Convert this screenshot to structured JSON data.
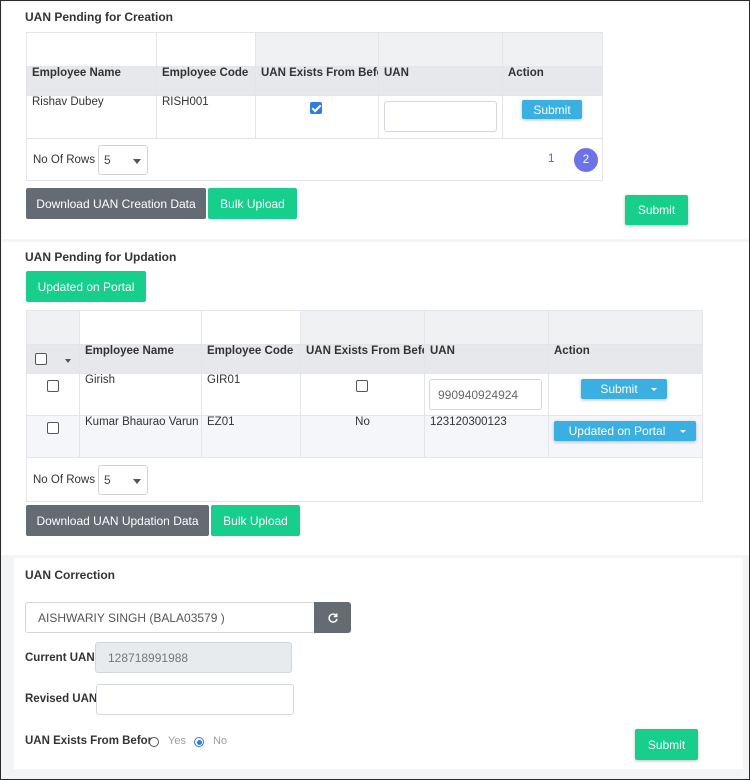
{
  "creation": {
    "title": "UAN Pending for Creation",
    "columns": [
      "Employee Name",
      "Employee Code",
      "UAN Exists From Before",
      "UAN",
      "Action"
    ],
    "rows": [
      {
        "name": "Rishav Dubey",
        "code": "RISH001",
        "uan_exists": true,
        "uan": "",
        "action": "Submit"
      }
    ],
    "rows_label": "No Of Rows :",
    "rows_value": "5",
    "pages": [
      "1",
      "2"
    ],
    "active_page": "2",
    "download_label": "Download UAN Creation Data",
    "bulk_upload_label": "Bulk Upload",
    "submit_label": "Submit"
  },
  "updation": {
    "title": "UAN Pending for Updation",
    "updated_portal_label": "Updated on Portal",
    "columns": [
      "Employee Name",
      "Employee Code",
      "UAN Exists From Before",
      "UAN",
      "Action"
    ],
    "rows": [
      {
        "name": "Girish",
        "code": "GIR01",
        "uan_exists": "",
        "uan": "990940924924",
        "action": "Submit"
      },
      {
        "name": "Kumar Bhaurao Varun",
        "code": "EZ01",
        "uan_exists": "No",
        "uan": "123120300123",
        "action": "Updated on Portal"
      }
    ],
    "rows_label": "No Of Rows :",
    "rows_value": "5",
    "download_label": "Download UAN Updation Data",
    "bulk_upload_label": "Bulk Upload"
  },
  "correction": {
    "title": "UAN Correction",
    "employee_value": "AISHWARIY SINGH (BALA03579 )",
    "current_uan_label": "Current UAN",
    "current_uan_value": "128718991988",
    "revised_uan_label": "Revised UAN",
    "revised_uan_value": "",
    "exists_label": "UAN Exists From Before",
    "yes_label": "Yes",
    "no_label": "No",
    "exists_selected": "No",
    "submit_label": "Submit"
  },
  "colors": {
    "green": "#16cf8d",
    "gray_button": "#646b73",
    "blue_button": "#3ab0e2",
    "active_page": "#6c72e8"
  }
}
